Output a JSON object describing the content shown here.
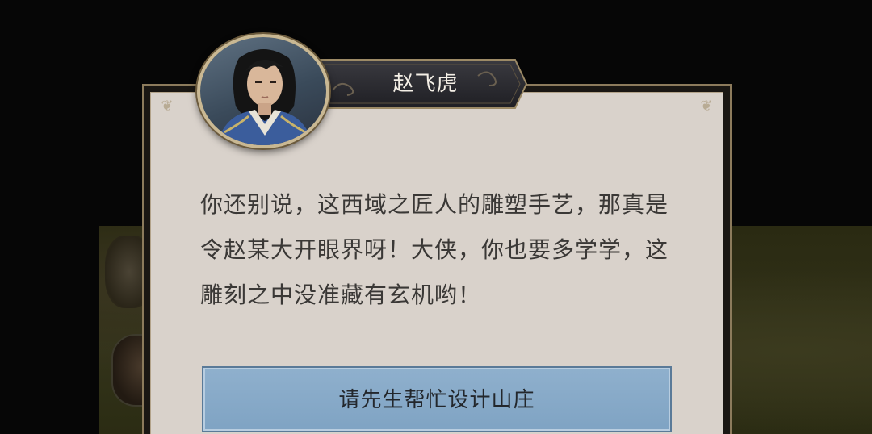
{
  "speaker": {
    "name": "赵飞虎"
  },
  "dialog": {
    "text": "你还别说，这西域之匠人的雕塑手艺，那真是令赵某大开眼界呀！大侠，你也要多学学，这雕刻之中没准藏有玄机哟！"
  },
  "choices": [
    {
      "label": "请先生帮忙设计山庄"
    }
  ],
  "colors": {
    "panel_fill": "#d9d2cb",
    "panel_border": "#8c7b5c",
    "banner_fill": "#2a2a2e",
    "button_fill": "#8fb0cd",
    "text_color": "#3a3836"
  },
  "icons": {
    "portrait": "character-portrait",
    "corner": "cloud-ornament-icon"
  }
}
